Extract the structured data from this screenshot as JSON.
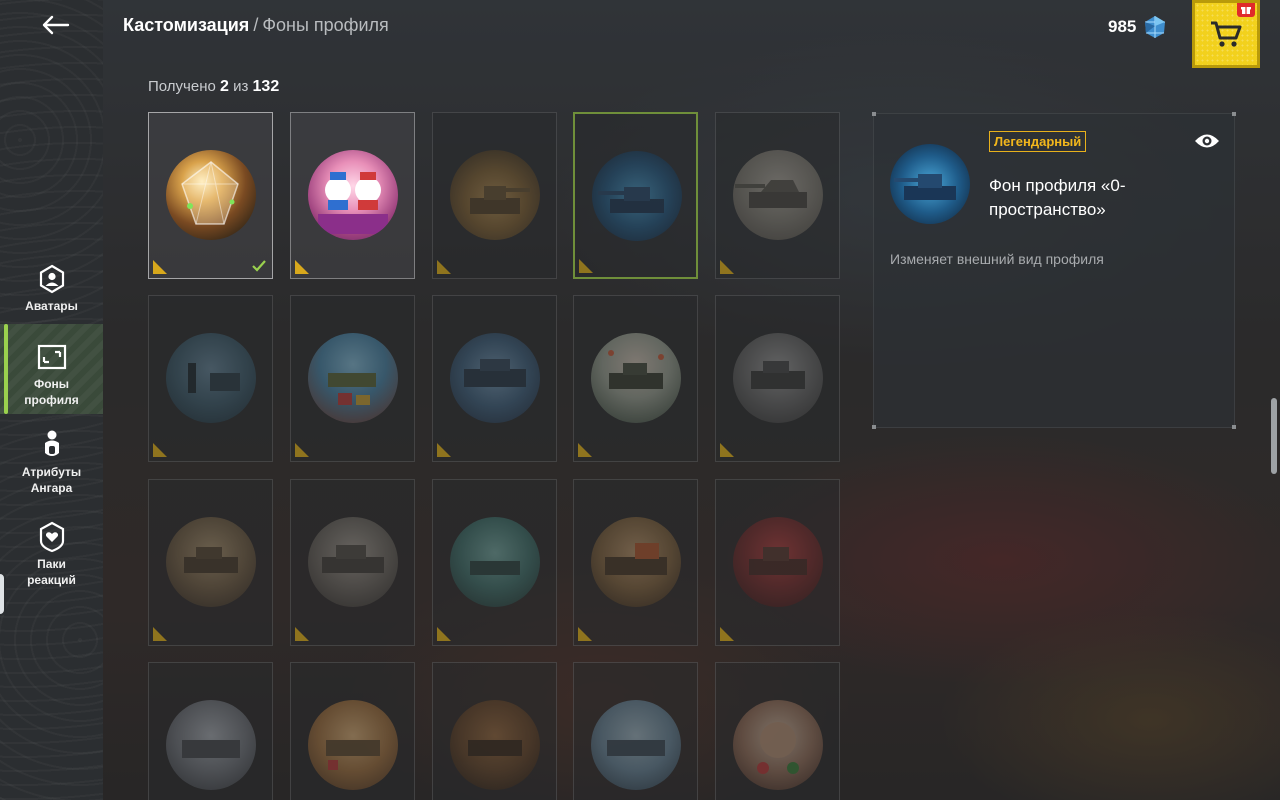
{
  "header": {
    "breadcrumb_root": "Кастомизация",
    "breadcrumb_separator": "/",
    "breadcrumb_current": "Фоны профиля",
    "currency_amount": "985"
  },
  "sidebar": {
    "items": [
      {
        "label": "Аватары",
        "icon": "avatar-icon",
        "active": false
      },
      {
        "label": "Фоны\nпрофиля",
        "icon": "profile-background-icon",
        "active": true
      },
      {
        "label": "Атрибуты\nАнгара",
        "icon": "hangar-attributes-icon",
        "active": false
      },
      {
        "label": "Паки\nреакций",
        "icon": "reaction-packs-icon",
        "active": false
      }
    ]
  },
  "collection": {
    "obtained_label": "Получено",
    "obtained_count": "2",
    "of_label": "из",
    "total_count": "132"
  },
  "detail": {
    "rarity": "Легендарный",
    "name": "Фон профиля «0-пространство»",
    "description": "Изменяет внешний вид профиля"
  },
  "colors": {
    "accent_green": "#9ad14e",
    "legendary_gold": "#f2b71c",
    "shop_yellow": "#f2d11d"
  }
}
